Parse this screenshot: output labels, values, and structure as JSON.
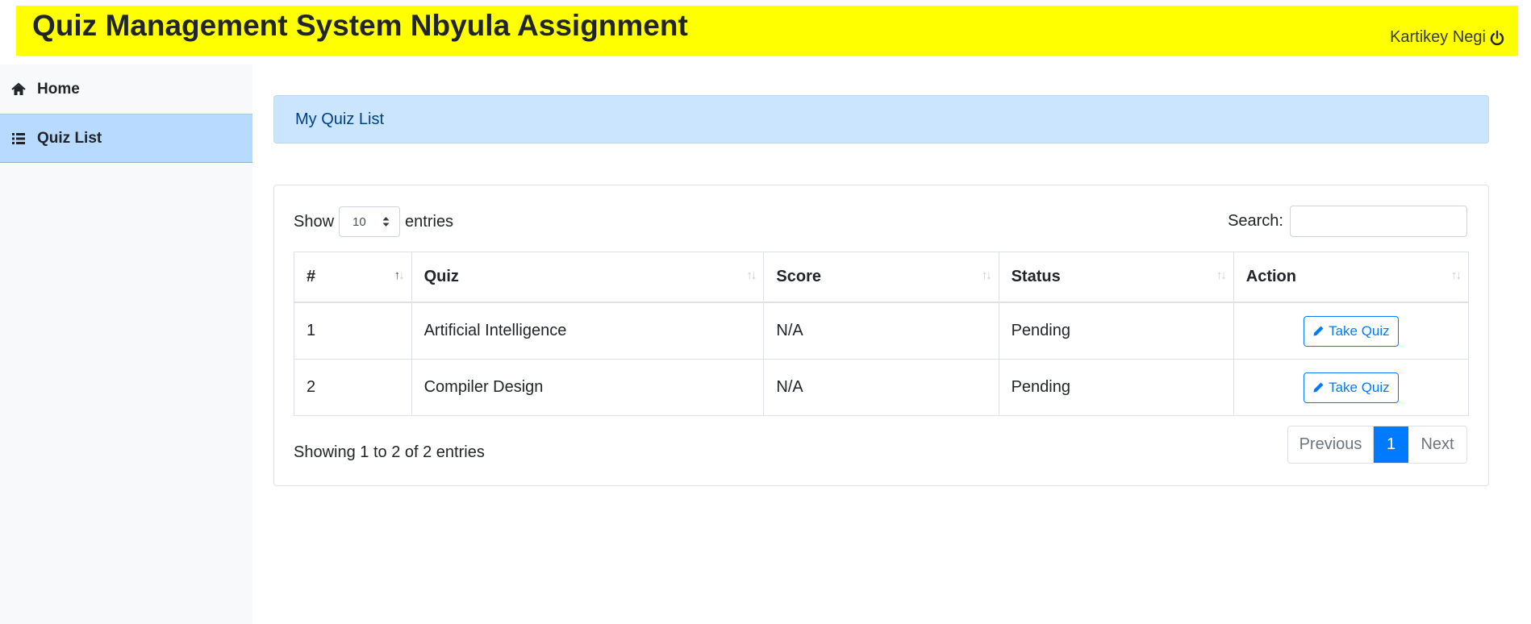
{
  "header": {
    "title": "Quiz Management System Nbyula Assignment",
    "user_name": "Kartikey Negi",
    "logout_icon": "power-icon",
    "background": "#ffff00"
  },
  "sidebar": {
    "items": [
      {
        "label": "Home",
        "icon": "home-icon",
        "active": false
      },
      {
        "label": "Quiz List",
        "icon": "list-icon",
        "active": true
      }
    ]
  },
  "banner": {
    "text": "My Quiz List"
  },
  "table_controls": {
    "show_label": "Show",
    "entries_label": "entries",
    "page_length": "10",
    "search_label": "Search:",
    "search_value": ""
  },
  "table": {
    "columns": [
      "#",
      "Quiz",
      "Score",
      "Status",
      "Action"
    ],
    "rows": [
      {
        "num": "1",
        "quiz": "Artificial Intelligence",
        "score": "N/A",
        "status": "Pending",
        "action": "Take Quiz"
      },
      {
        "num": "2",
        "quiz": "Compiler Design",
        "score": "N/A",
        "status": "Pending",
        "action": "Take Quiz"
      }
    ]
  },
  "footer": {
    "info": "Showing 1 to 2 of 2 entries",
    "previous": "Previous",
    "current_page": "1",
    "next": "Next"
  },
  "colors": {
    "accent": "#007bff",
    "active_sidebar": "#b8daff",
    "banner_bg": "#cce5ff"
  }
}
